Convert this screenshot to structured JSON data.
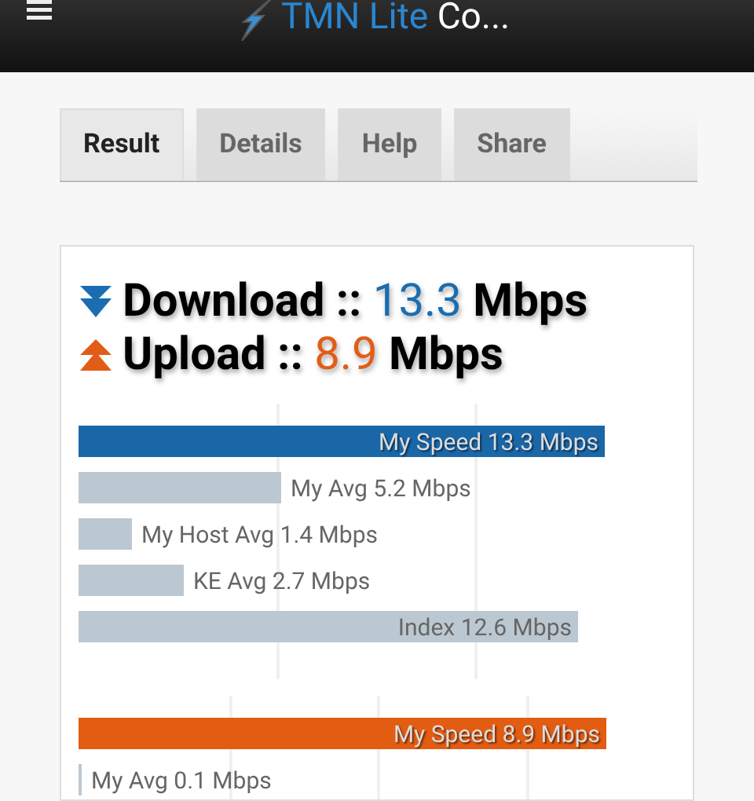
{
  "header": {
    "title_brand": "TMN Lite",
    "title_rest": "Co..."
  },
  "tabs": [
    {
      "label": "Result",
      "selected": true
    },
    {
      "label": "Details",
      "selected": false
    },
    {
      "label": "Help",
      "selected": false
    },
    {
      "label": "Share",
      "selected": false
    }
  ],
  "summary": [
    {
      "kind": "download",
      "label": "Download ::",
      "value": "13.3",
      "unit": "Mbps"
    },
    {
      "kind": "upload",
      "label": "Upload ::",
      "value": "8.9",
      "unit": "Mbps"
    }
  ],
  "download_bars": [
    {
      "kind": "mine",
      "label": "My Speed 13.3 Mbps"
    },
    {
      "kind": "other",
      "label": "My Avg 5.2 Mbps"
    },
    {
      "kind": "other",
      "label": "My Host Avg 1.4 Mbps"
    },
    {
      "kind": "other",
      "label": "KE Avg 2.7 Mbps"
    },
    {
      "kind": "other",
      "label": "Index 12.6 Mbps"
    }
  ],
  "upload_bars": [
    {
      "kind": "mine",
      "label": "My Speed 8.9 Mbps"
    },
    {
      "kind": "other",
      "label": "My Avg 0.1 Mbps"
    }
  ]
}
